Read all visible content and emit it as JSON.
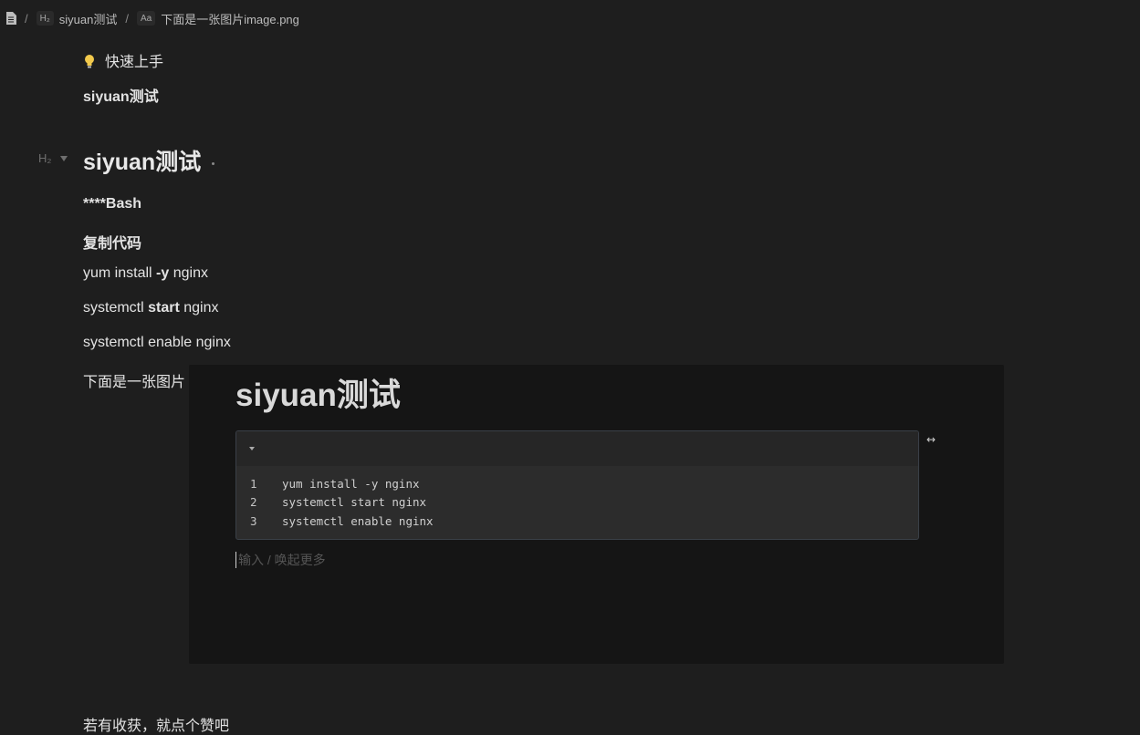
{
  "breadcrumb": {
    "doc_icon": "file-icon",
    "separator": "/",
    "items": [
      {
        "chip": "H₂",
        "label": "siyuan测试"
      },
      {
        "chip": "Aa",
        "label": "下面是一张图片image.png"
      }
    ]
  },
  "editor": {
    "tip_icon": "lightbulb-icon",
    "tip_text": "快速上手",
    "line1": "siyuan测试",
    "heading": "siyuan测试",
    "heading_marker": "H₂",
    "bash_line": "****Bash",
    "copy_line": "复制代码",
    "cmd1_a": "yum install ",
    "cmd1_b": "-y",
    "cmd1_c": " nginx",
    "cmd2_a": "systemctl ",
    "cmd2_b": "start",
    "cmd2_c": " nginx",
    "cmd3": "systemctl enable nginx",
    "image_caption": "下面是一张图片",
    "footer": "若有收获，就点个赞吧"
  },
  "embedded_image": {
    "title": "siyuan测试",
    "code_lines": [
      {
        "n": "1",
        "text": "yum install -y nginx"
      },
      {
        "n": "2",
        "text": "systemctl start nginx"
      },
      {
        "n": "3",
        "text": "systemctl enable nginx"
      }
    ],
    "expand_glyph": "↔",
    "input_placeholder": "输入 / 唤起更多"
  }
}
